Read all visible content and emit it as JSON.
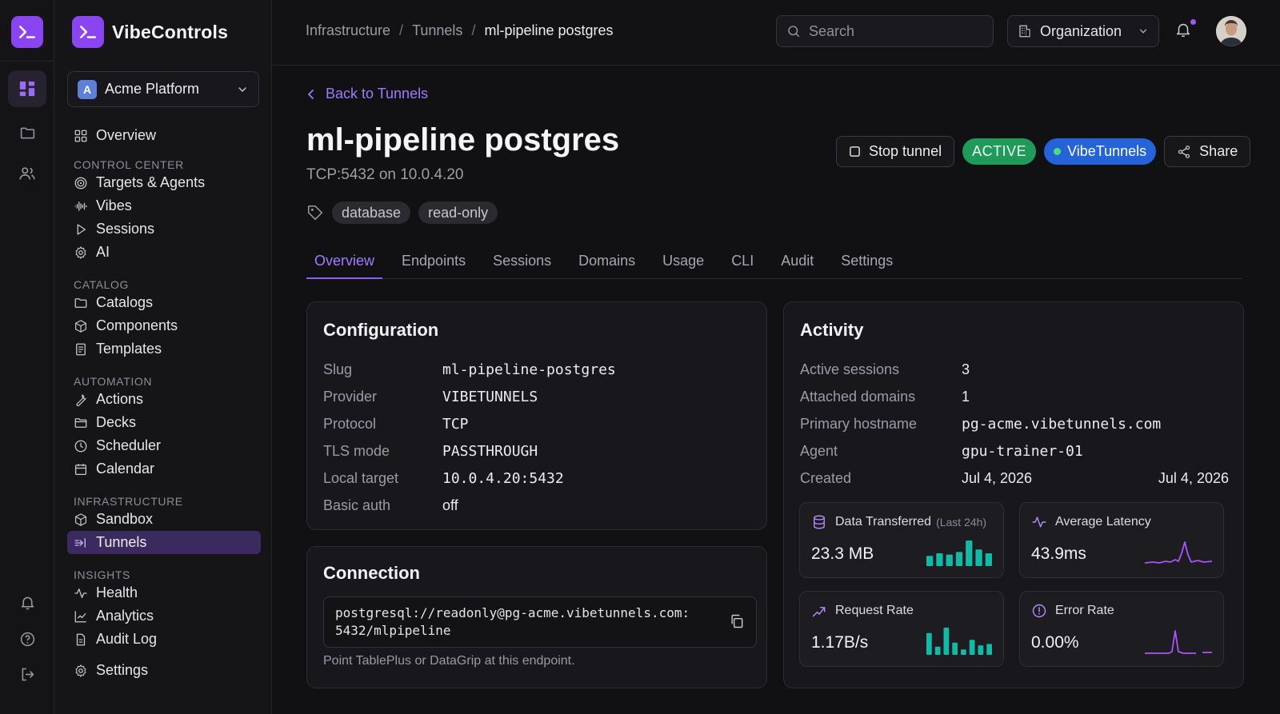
{
  "brand": {
    "name": "VibeControls",
    "accent": "#8b45f0"
  },
  "org_selector": {
    "initial": "A",
    "name": "Acme Platform"
  },
  "sidebar": {
    "overview": "Overview",
    "sections": [
      {
        "title": "CONTROL CENTER",
        "items": [
          "Targets & Agents",
          "Vibes",
          "Sessions",
          "AI"
        ]
      },
      {
        "title": "CATALOG",
        "items": [
          "Catalogs",
          "Components",
          "Templates"
        ]
      },
      {
        "title": "AUTOMATION",
        "items": [
          "Actions",
          "Decks",
          "Scheduler",
          "Calendar"
        ]
      },
      {
        "title": "INFRASTRUCTURE",
        "items": [
          "Sandbox",
          "Tunnels"
        ]
      },
      {
        "title": "INSIGHTS",
        "items": [
          "Health",
          "Analytics",
          "Audit Log"
        ]
      }
    ],
    "settings": "Settings",
    "active_item": "Tunnels"
  },
  "topbar": {
    "breadcrumb": [
      "Infrastructure",
      "Tunnels",
      "ml-pipeline postgres"
    ],
    "search_placeholder": "Search",
    "org_button": "Organization"
  },
  "page": {
    "back_label": "Back to Tunnels",
    "title": "ml-pipeline postgres",
    "subtitle": "TCP:5432 on 10.0.4.20",
    "tags": [
      "database",
      "read-only"
    ],
    "actions": {
      "stop": "Stop tunnel",
      "status": "ACTIVE",
      "provider_badge": "VibeTunnels",
      "share": "Share"
    },
    "tabs": [
      "Overview",
      "Endpoints",
      "Sessions",
      "Domains",
      "Usage",
      "CLI",
      "Audit",
      "Settings"
    ],
    "active_tab": "Overview"
  },
  "configuration": {
    "title": "Configuration",
    "rows": [
      {
        "key": "Slug",
        "value": "ml-pipeline-postgres"
      },
      {
        "key": "Provider",
        "value": "VIBETUNNELS"
      },
      {
        "key": "Protocol",
        "value": "TCP"
      },
      {
        "key": "TLS mode",
        "value": "PASSTHROUGH"
      },
      {
        "key": "Local target",
        "value": "10.0.4.20:5432"
      },
      {
        "key": "Basic auth",
        "value": "off"
      }
    ]
  },
  "connection": {
    "title": "Connection",
    "line1": "postgresql://readonly@pg-acme.vibetunnels.com:",
    "line2": "5432/mlpipeline",
    "hint": "Point TablePlus or DataGrip at this endpoint."
  },
  "activity": {
    "title": "Activity",
    "rows": [
      {
        "key": "Active sessions",
        "value": "3"
      },
      {
        "key": "Attached domains",
        "value": "1"
      },
      {
        "key": "Primary hostname",
        "value": "pg-acme.vibetunnels.com"
      },
      {
        "key": "Agent",
        "value": "gpu-trainer-01"
      },
      {
        "key": "Created",
        "value": "Jul 4, 2026",
        "extra": "Jul 4, 2026"
      }
    ],
    "metrics": {
      "data_transferred": {
        "label": "Data Transferred",
        "sub": "(Last 24h)",
        "value": "23.3 MB",
        "bars": [
          0.4,
          0.5,
          0.45,
          0.55,
          1.0,
          0.65,
          0.5
        ]
      },
      "avg_latency": {
        "label": "Average Latency",
        "value": "43.9ms"
      },
      "request_rate": {
        "label": "Request Rate",
        "value": "1.17B/s",
        "bars": [
          0.8,
          0.3,
          1.0,
          0.45,
          0.2,
          0.55,
          0.35,
          0.4
        ]
      },
      "error_rate": {
        "label": "Error Rate",
        "value": "0.00%"
      }
    }
  },
  "colors": {
    "success": "#1f9a58",
    "info": "#2563d9",
    "teal": "#14b8a6",
    "purple": "#a855f7"
  }
}
